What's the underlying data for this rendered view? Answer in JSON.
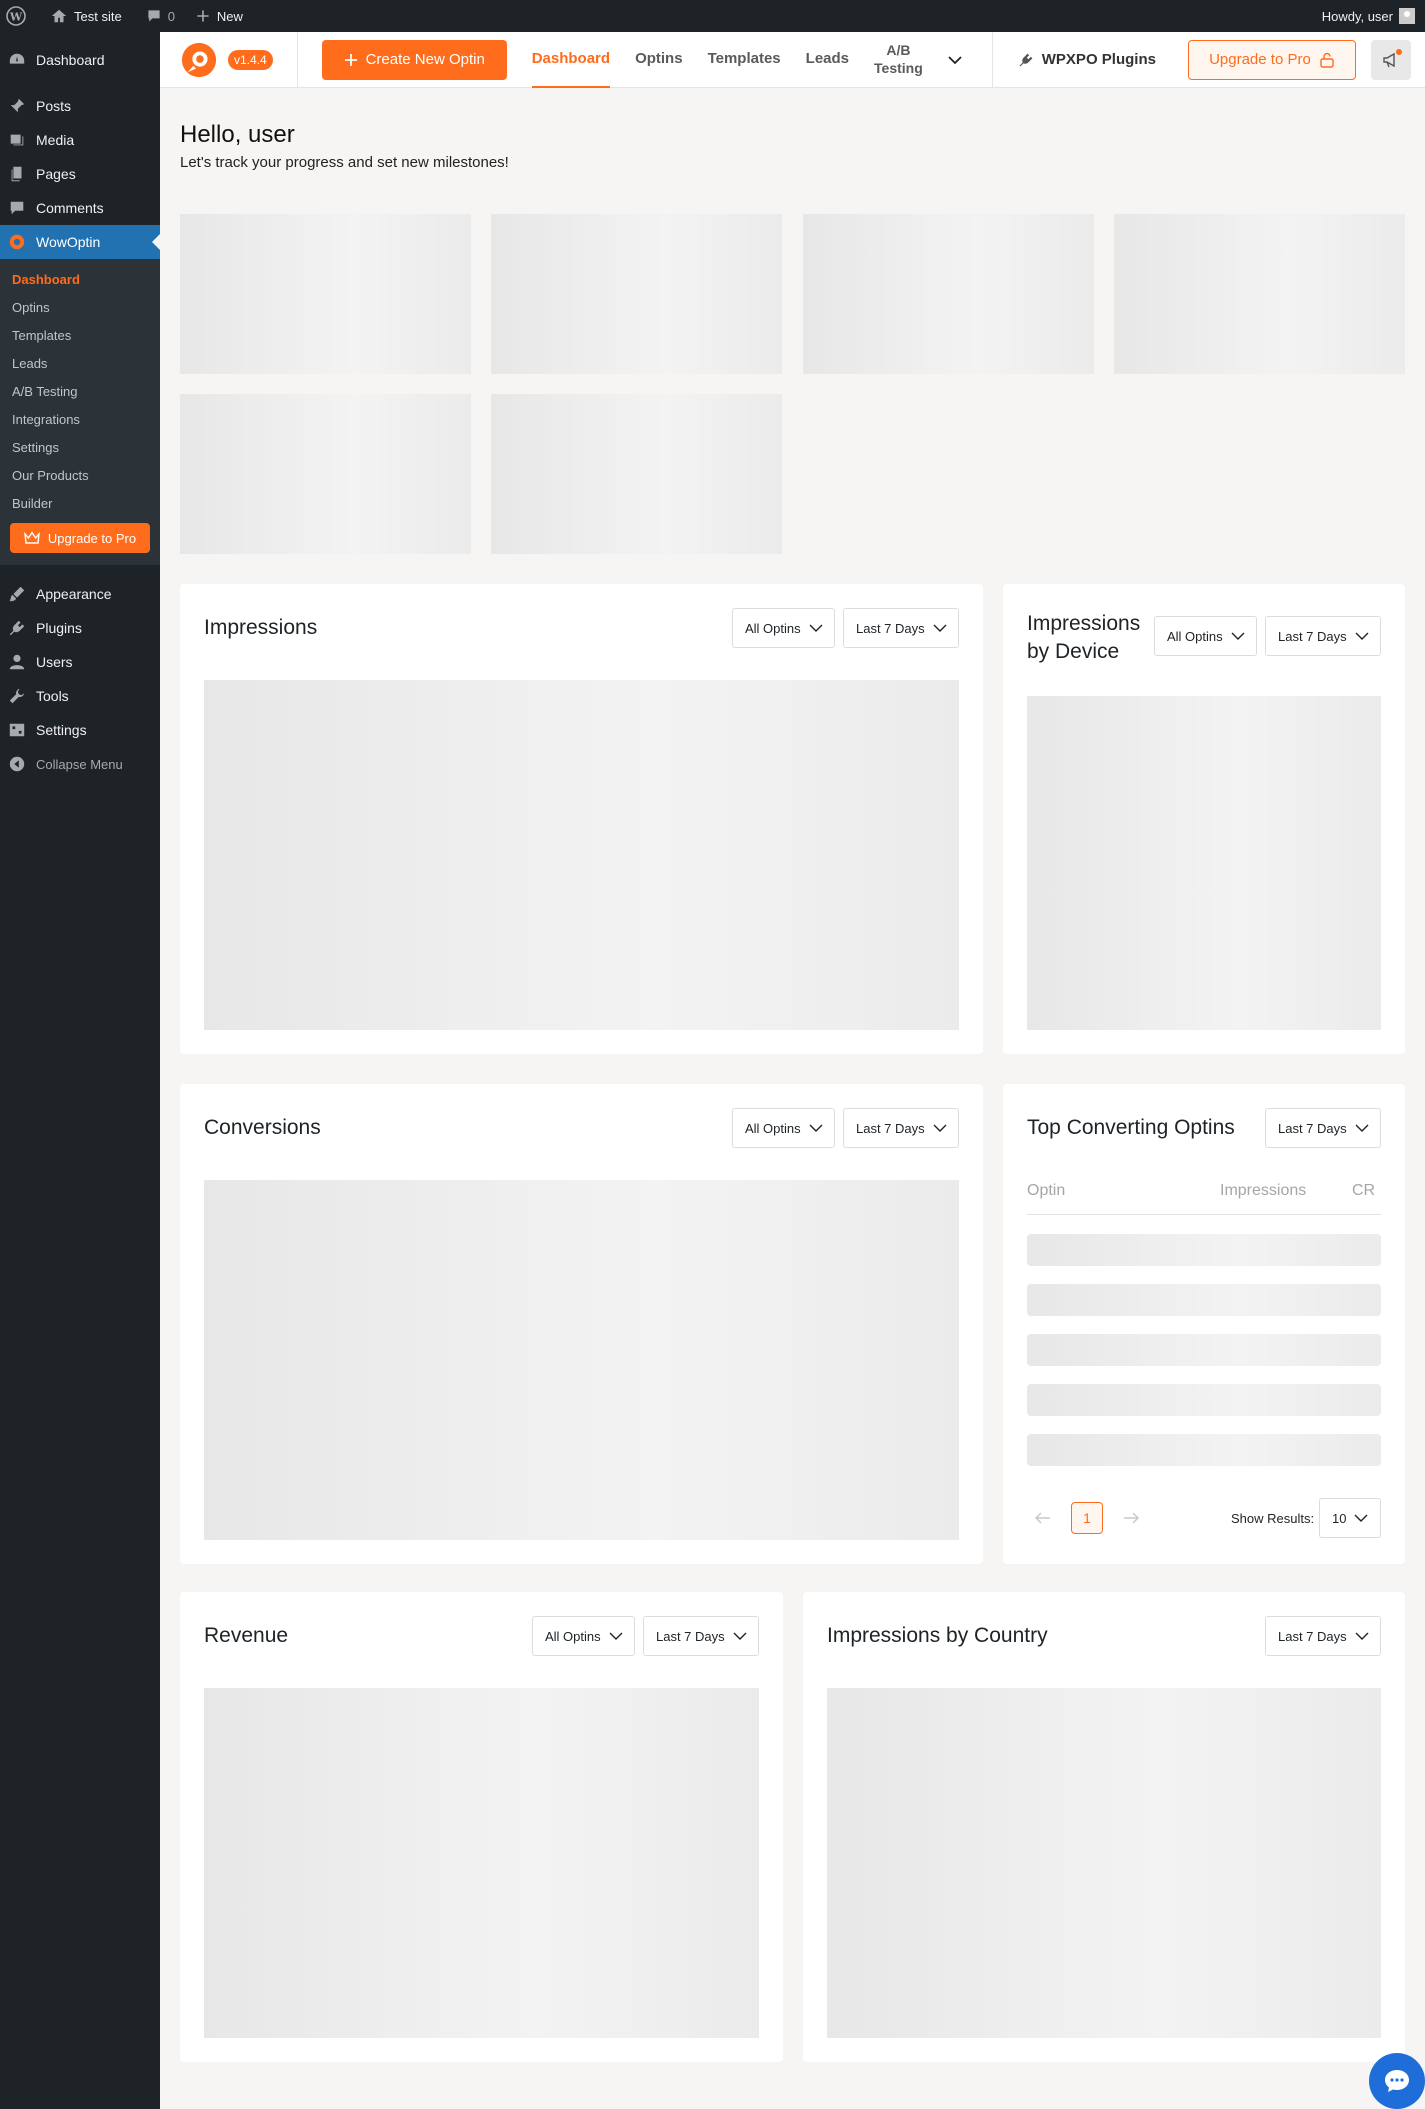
{
  "admin_bar": {
    "site_name": "Test site",
    "comments_count": "0",
    "new_label": "New",
    "greeting": "Howdy, user"
  },
  "sidebar": {
    "items_top": [
      {
        "label": "Dashboard",
        "icon": "dashboard-icon"
      },
      {
        "label": "Posts",
        "icon": "pin-icon"
      },
      {
        "label": "Media",
        "icon": "media-icon"
      },
      {
        "label": "Pages",
        "icon": "pages-icon"
      },
      {
        "label": "Comments",
        "icon": "comment-icon"
      }
    ],
    "current": {
      "label": "WowOptin",
      "icon": "wowoptin-icon"
    },
    "submenu": [
      "Dashboard",
      "Optins",
      "Templates",
      "Leads",
      "A/B Testing",
      "Integrations",
      "Settings",
      "Our Products",
      "Builder"
    ],
    "submenu_upgrade": "Upgrade to Pro",
    "items_bottom": [
      {
        "label": "Appearance",
        "icon": "brush-icon"
      },
      {
        "label": "Plugins",
        "icon": "plugin-icon"
      },
      {
        "label": "Users",
        "icon": "user-icon"
      },
      {
        "label": "Tools",
        "icon": "wrench-icon"
      },
      {
        "label": "Settings",
        "icon": "settings-icon"
      }
    ],
    "collapse": "Collapse Menu"
  },
  "header": {
    "version": "v1.4.4",
    "create_label": "Create New Optin",
    "nav": [
      "Dashboard",
      "Optins",
      "Templates",
      "Leads"
    ],
    "nav_ab_line1": "A/B",
    "nav_ab_line2": "Testing",
    "wpxpo": "WPXPO Plugins",
    "upgrade": "Upgrade to Pro",
    "brand_color": "#fe6c1c"
  },
  "greeting": {
    "title": "Hello, user",
    "subtitle": "Let's track your progress and set new milestones!"
  },
  "filters": {
    "all_optins": "All Optins",
    "last_7_days": "Last 7 Days"
  },
  "cards": {
    "impressions": "Impressions",
    "impressions_device_line1": "Impressions",
    "impressions_device_line2": "by Device",
    "conversions": "Conversions",
    "top_converting": "Top Converting Optins",
    "revenue": "Revenue",
    "impressions_country": "Impressions by Country"
  },
  "table": {
    "col_optin": "Optin",
    "col_impressions": "Impressions",
    "col_cr": "CR",
    "page": "1",
    "show_results_label": "Show Results:",
    "show_results_value": "10"
  }
}
